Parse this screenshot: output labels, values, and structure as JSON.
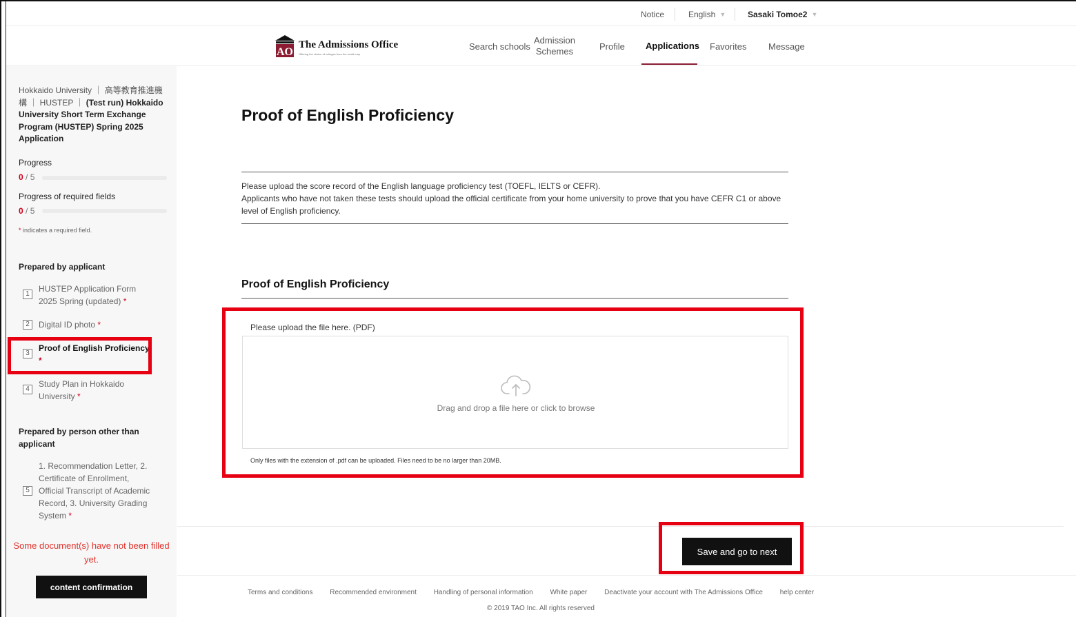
{
  "topbar": {
    "notice": "Notice",
    "language": "English",
    "user": "Sasaki Tomoe2"
  },
  "header": {
    "logo_title": "The Admissions Office",
    "logo_subtitle": "Offering the choice of colleges from the world map",
    "nav": {
      "search_schools": "Search schools",
      "admission_schemes_1": "Admission",
      "admission_schemes_2": "Schemes",
      "profile": "Profile",
      "applications": "Applications",
      "favorites": "Favorites",
      "message": "Message"
    }
  },
  "sidebar": {
    "crumb_plain": "Hokkaido University ｜ 高等教育推進機構 ｜ HUSTEP ｜ ",
    "crumb_bold": "(Test run) Hokkaido University Short Term Exchange Program (HUSTEP) Spring 2025 Application",
    "progress_label": "Progress",
    "progress_done": "0",
    "progress_total": "/ 5",
    "progress_fraction": 0,
    "required_label": "Progress of required fields",
    "required_done": "0",
    "required_total": "/ 5",
    "required_fraction": 0,
    "star": "*",
    "required_note": "indicates a required field.",
    "section_applicant": "Prepared by applicant",
    "steps": [
      {
        "num": "1",
        "label": "HUSTEP Application Form 2025 Spring (updated)"
      },
      {
        "num": "2",
        "label": "Digital ID photo"
      },
      {
        "num": "3",
        "label": "Proof of English Proficiency"
      },
      {
        "num": "4",
        "label": "Study Plan in Hokkaido University"
      }
    ],
    "section_other": "Prepared by person other than applicant",
    "step5": {
      "num": "5",
      "label": "1. Recommendation Letter, 2. Certificate of Enrollment, Official Transcript of Academic Record, 3. University Grading System"
    },
    "warning": "Some document(s) have not been filled yet.",
    "confirm_button": "content confirmation"
  },
  "main": {
    "title": "Proof of English Proficiency",
    "desc_line1": "Please upload the score record of the English language proficiency test (TOEFL, IELTS or CEFR).",
    "desc_line2": "Applicants who have not taken these tests should upload the official certificate from your home university to prove that you have CEFR C1 or above level of English proficiency.",
    "section_title": "Proof of English Proficiency",
    "upload_label": "Please upload the file here. (PDF)",
    "dropzone_text": "Drag and drop a file here or click to browse",
    "upload_note": "Only files with the extension of .pdf can be uploaded. Files need to be no larger than 20MB.",
    "save_button": "Save and go to next"
  },
  "footer": {
    "links": [
      "Terms and conditions",
      "Recommended environment",
      "Handling of personal information",
      "White paper",
      "Deactivate your account with The Admissions Office",
      "help center"
    ],
    "copyright": "© 2019 TAO Inc. All rights reserved"
  },
  "colors": {
    "accent": "#8b1c32",
    "highlight": "#e60012",
    "required": "#d0021b"
  }
}
